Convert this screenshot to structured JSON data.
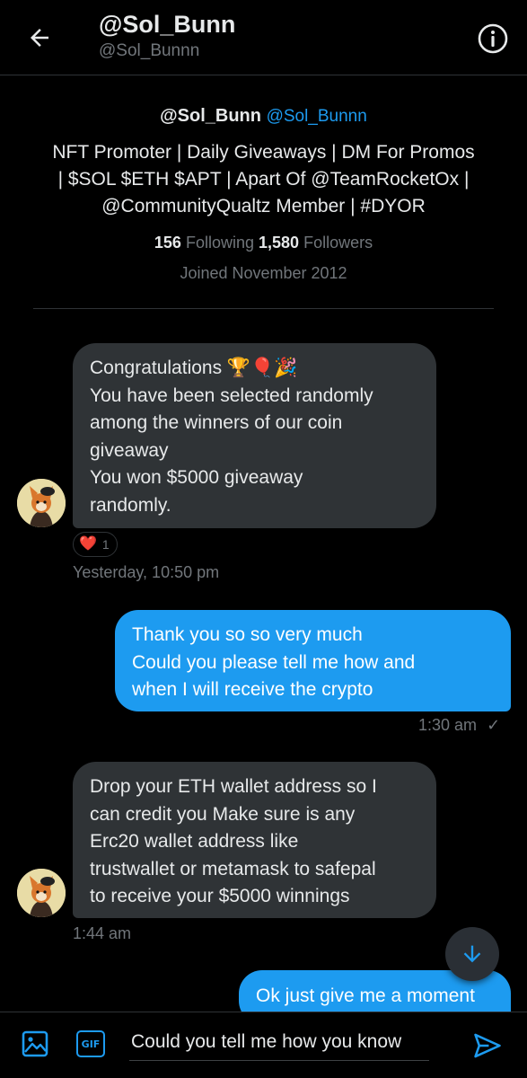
{
  "header": {
    "title": "@Sol_Bunn",
    "handle": "@Sol_Bunnn"
  },
  "profile": {
    "name": "@Sol_Bunn",
    "handle": "@Sol_Bunnn",
    "bio_lines": [
      "NFT Promoter | Daily Giveaways | DM For Promos",
      "| $SOL $ETH $APT | Apart Of @TeamRocketOx |",
      "@CommunityQualtz Member | #DYOR"
    ],
    "following_count": "156",
    "following_label": "Following",
    "followers_count": "1,580",
    "followers_label": "Followers",
    "joined": "Joined November 2012"
  },
  "messages": [
    {
      "direction": "incoming",
      "lines": [
        "Congratulations 🏆🎈🎉",
        "You have been  selected randomly",
        "among the winners of our coin",
        "giveaway",
        "You won $5000 giveaway",
        "randomly."
      ],
      "reaction": {
        "emoji": "❤️",
        "count": "1"
      },
      "timestamp": "Yesterday, 10:50 pm"
    },
    {
      "direction": "outgoing",
      "lines": [
        "Thank you so so very much",
        "Could you please tell me how and",
        "when I will receive the crypto"
      ],
      "timestamp": "1:30 am",
      "status": "✓"
    },
    {
      "direction": "incoming",
      "lines": [
        "Drop your ETH wallet address so I",
        "can credit you Make sure is any",
        "Erc20 wallet address like",
        "trustwallet or metamask to safepal",
        "to receive your $5000 winnings"
      ],
      "timestamp": "1:44 am"
    },
    {
      "direction": "outgoing",
      "lines": [
        "Ok just give me a moment"
      ]
    }
  ],
  "composer": {
    "value": "Could you tell me how you know",
    "gif_label": "GIF"
  },
  "icons": {
    "back": "arrow-left-icon",
    "info": "info-icon",
    "scroll": "arrow-down-icon",
    "media": "image-icon",
    "gif": "gif-icon",
    "send": "send-icon"
  },
  "colors": {
    "accent": "#1d9bf0",
    "background": "#000000",
    "incoming_bubble": "#2f3336",
    "muted_text": "#71767b"
  }
}
